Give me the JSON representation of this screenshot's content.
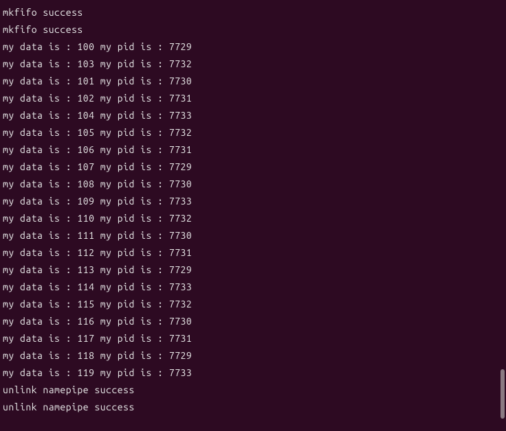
{
  "terminal": {
    "lines": [
      "mkfifo success",
      "mkfifo success",
      "my data is : 100 my pid is : 7729",
      "my data is : 103 my pid is : 7732",
      "my data is : 101 my pid is : 7730",
      "my data is : 102 my pid is : 7731",
      "my data is : 104 my pid is : 7733",
      "my data is : 105 my pid is : 7732",
      "my data is : 106 my pid is : 7731",
      "my data is : 107 my pid is : 7729",
      "my data is : 108 my pid is : 7730",
      "my data is : 109 my pid is : 7733",
      "my data is : 110 my pid is : 7732",
      "my data is : 111 my pid is : 7730",
      "my data is : 112 my pid is : 7731",
      "my data is : 113 my pid is : 7729",
      "my data is : 114 my pid is : 7733",
      "my data is : 115 my pid is : 7732",
      "my data is : 116 my pid is : 7730",
      "my data is : 117 my pid is : 7731",
      "my data is : 118 my pid is : 7729",
      "my data is : 119 my pid is : 7733",
      "unlink namepipe success",
      "unlink namepipe success"
    ]
  }
}
